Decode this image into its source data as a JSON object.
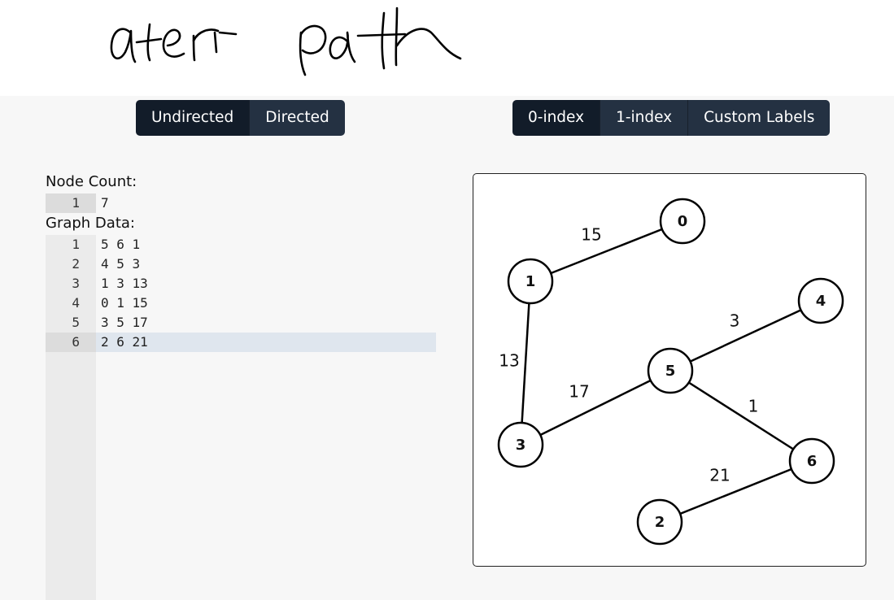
{
  "handwriting": {
    "text": "after path"
  },
  "direction_toggle": {
    "undirected": "Undirected",
    "directed": "Directed",
    "selected": "Undirected"
  },
  "index_toggle": {
    "zero_index": "0-index",
    "one_index": "1-index",
    "custom_labels": "Custom Labels",
    "selected": "0-index"
  },
  "node_count": {
    "label": "Node Count:",
    "lines": [
      {
        "num": "1",
        "text": "7"
      }
    ]
  },
  "graph_data": {
    "label": "Graph Data:",
    "lines": [
      {
        "num": "1",
        "text": "5 6 1"
      },
      {
        "num": "2",
        "text": "4 5 3"
      },
      {
        "num": "3",
        "text": "1 3 13"
      },
      {
        "num": "4",
        "text": "0 1 15"
      },
      {
        "num": "5",
        "text": "3 5 17"
      },
      {
        "num": "6",
        "text": "2 6 21"
      }
    ]
  },
  "graph": {
    "nodes": [
      "0",
      "1",
      "2",
      "3",
      "4",
      "5",
      "6"
    ],
    "edges": [
      {
        "from": "5",
        "to": "6",
        "weight": "1"
      },
      {
        "from": "4",
        "to": "5",
        "weight": "3"
      },
      {
        "from": "1",
        "to": "3",
        "weight": "13"
      },
      {
        "from": "0",
        "to": "1",
        "weight": "15"
      },
      {
        "from": "3",
        "to": "5",
        "weight": "17"
      },
      {
        "from": "2",
        "to": "6",
        "weight": "21"
      }
    ]
  },
  "colors": {
    "toggle_bg": "#243142",
    "toggle_active": "#121c29",
    "app_bg": "#f7f7f7",
    "active_line": "#dfe6ee"
  }
}
